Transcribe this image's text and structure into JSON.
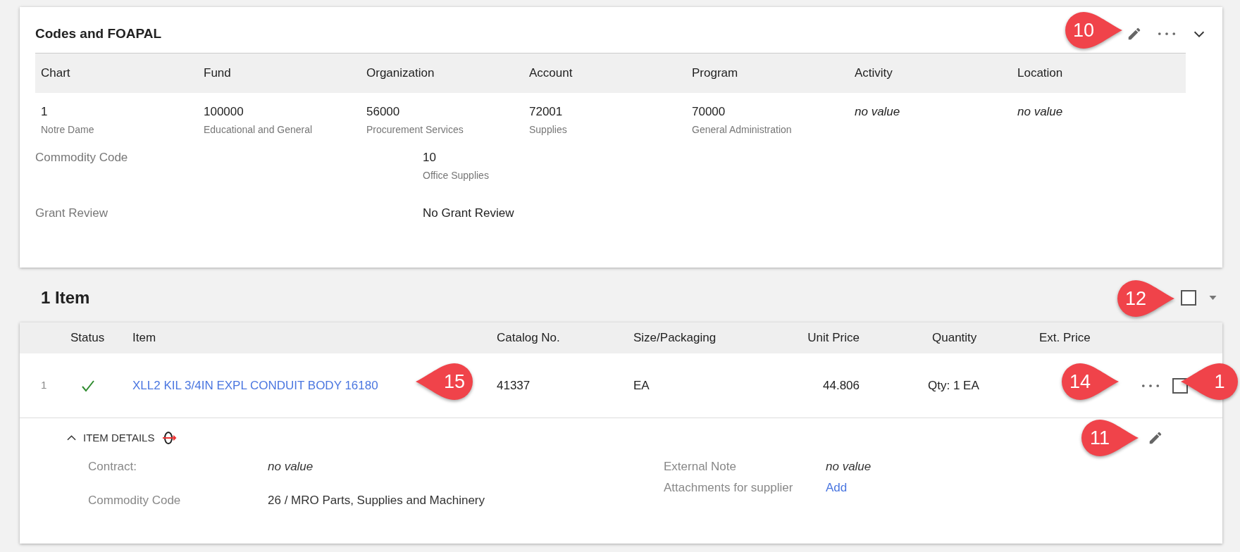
{
  "foapal_card": {
    "title": "Codes and FOAPAL",
    "callout": "10",
    "columns": [
      "Chart",
      "Fund",
      "Organization",
      "Account",
      "Program",
      "Activity",
      "Location"
    ],
    "values": [
      {
        "kind": "code",
        "value": "1",
        "description": "Notre Dame"
      },
      {
        "kind": "code",
        "value": "100000",
        "description": "Educational and General"
      },
      {
        "kind": "code",
        "value": "56000",
        "description": "Procurement Services"
      },
      {
        "kind": "code",
        "value": "72001",
        "description": "Supplies"
      },
      {
        "kind": "code",
        "value": "70000",
        "description": "General Administration"
      },
      {
        "kind": "empty",
        "value": "no value"
      },
      {
        "kind": "empty",
        "value": "no value"
      }
    ],
    "fields": [
      {
        "label": "Commodity Code",
        "value": "10",
        "description": "Office Supplies"
      },
      {
        "label": "Grant Review",
        "value": "No Grant Review"
      }
    ]
  },
  "items_section": {
    "title": "1 Item",
    "callout": "12",
    "select_all_checked": false
  },
  "items_table": {
    "columns": [
      "Status",
      "Item",
      "Catalog No.",
      "Size/Packaging",
      "Unit Price",
      "Quantity",
      "Ext. Price"
    ],
    "rows": [
      {
        "number": "1",
        "item": "XLL2 KIL 3/4IN EXPL CONDUIT BODY 16180",
        "item_callout": "15",
        "catalog_no": "41337",
        "size": "EA",
        "unit_price": "44.806",
        "quantity": "Qty: 1 EA",
        "actions_callout": "14",
        "checkbox_callout": "1",
        "checked": false
      }
    ]
  },
  "item_details": {
    "label": "ITEM DETAILS",
    "expanded": true,
    "callout": "11",
    "left": [
      {
        "kind": "empty",
        "label": "Contract:",
        "value": "no value"
      },
      {
        "kind": "text",
        "label": "Commodity Code",
        "value": "26 / MRO Parts, Supplies and Machinery"
      }
    ],
    "right": [
      {
        "kind": "empty",
        "label": "External Note",
        "value": "no value"
      },
      {
        "kind": "link",
        "label": "Attachments for supplier",
        "value": "Add"
      }
    ]
  }
}
